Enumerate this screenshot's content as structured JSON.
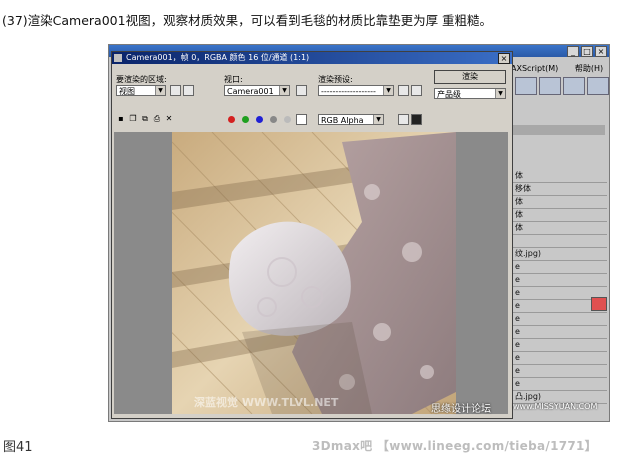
{
  "caption": "(37)渲染Camera001视图，观察材质效果，可以看到毛毯的材质比靠垫更为厚 重粗糙。",
  "figure_label": "图41",
  "footer_credit": "3Dmax吧 【www.lineeg.com/tieba/1771】",
  "app": {
    "menu_right": [
      "AXScript(M)",
      "帮助(H)"
    ],
    "window_buttons": [
      "_",
      "□",
      "×"
    ],
    "panel_rows": [
      "体",
      "移体",
      "体",
      "体",
      "体",
      "",
      "纹.jpg)",
      "e",
      "e",
      "e",
      "e",
      "e",
      "e",
      "e",
      "e",
      "e",
      "e",
      "凸.jpg)"
    ]
  },
  "render_window": {
    "title": "Camera001，帧 0，RGBA 颜色 16 位/通道 (1:1)",
    "area_label": "要渲染的区域:",
    "area_value": "视图",
    "viewport_label": "视口:",
    "viewport_value": "Camera001",
    "preset_label": "渲染预设:",
    "preset_value": "-------------------",
    "render_button": "渲染",
    "product_value": "产品级",
    "channel_value": "RGB Alpha",
    "close_button": "×"
  },
  "watermarks": {
    "image_overlay": "深蓝视觉 WWW.TLVL.NET",
    "forum": "思缘设计论坛",
    "site": "www.MISSYUAN.COM"
  },
  "colors": {
    "title_bar": "#0a246a",
    "panel": "#d4d0c8",
    "floor": "#d8c4a0",
    "red_dot": "#d42020",
    "green_dot": "#20a020",
    "blue_dot": "#2020d4"
  }
}
